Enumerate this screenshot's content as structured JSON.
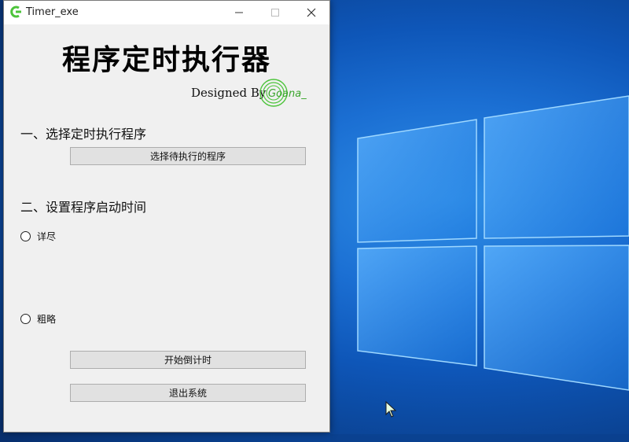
{
  "window": {
    "title": "Timer_exe",
    "icon": "app-logo-icon"
  },
  "header": {
    "title": "程序定时执行器",
    "designed_by": "Designed By",
    "logo_text": "Goana_"
  },
  "section1": {
    "label": "一、选择定时执行程序",
    "choose_button": "选择待执行的程序"
  },
  "section2": {
    "label": "二、设置程序启动时间",
    "options": [
      {
        "label": "详尽",
        "selected": false
      },
      {
        "label": "粗略",
        "selected": false
      }
    ]
  },
  "actions": {
    "start_button": "开始倒计时",
    "exit_button": "退出系统"
  },
  "colors": {
    "window_bg": "#f0f0f0",
    "titlebar_bg": "#ffffff",
    "button_bg": "#e1e1e1",
    "logo_green": "#4cc43a",
    "wallpaper_blue": "#1b6fd3"
  }
}
